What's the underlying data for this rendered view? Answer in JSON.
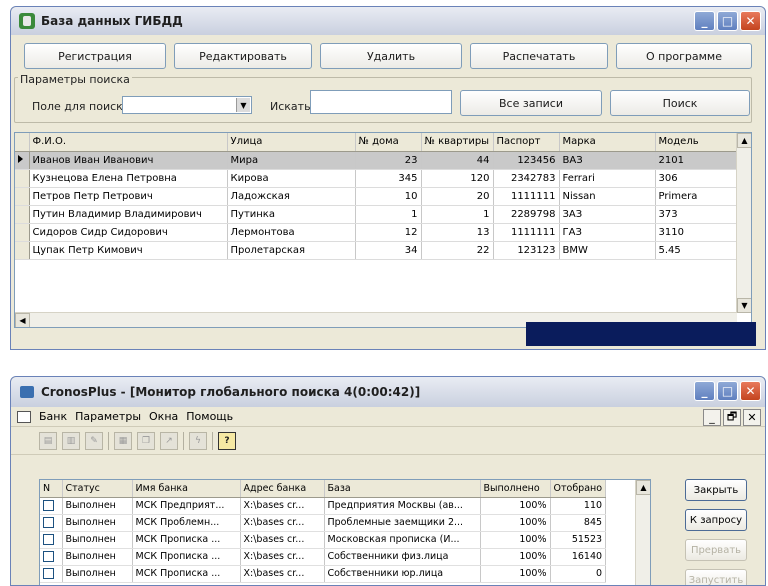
{
  "window1": {
    "title": "База данных ГИБДД",
    "buttons": {
      "register": "Регистрация",
      "edit": "Редактировать",
      "delete": "Удалить",
      "print": "Распечатать",
      "about": "О программе"
    },
    "search": {
      "group_label": "Параметры поиска",
      "field_label": "Поле для поиска",
      "field_value": "",
      "query_label": "Искать",
      "query_value": "",
      "all_records": "Все записи",
      "find": "Поиск"
    },
    "table": {
      "columns": [
        "Ф.И.О.",
        "Улица",
        "№ дома",
        "№ квартиры",
        "Паспорт",
        "Марка",
        "Модель"
      ],
      "rows": [
        [
          "Иванов Иван Иванович",
          "Мира",
          "23",
          "44",
          "123456",
          "ВАЗ",
          "2101"
        ],
        [
          "Кузнецова Елена Петровна",
          "Кирова",
          "345",
          "120",
          "2342783",
          "Ferrari",
          "306"
        ],
        [
          "Петров Петр Петрович",
          "Ладожская",
          "10",
          "20",
          "1111111",
          "Nissan",
          "Primera"
        ],
        [
          "Путин Владимир Владимирович",
          "Путинка",
          "1",
          "1",
          "2289798",
          "ЗАЗ",
          "373"
        ],
        [
          "Сидоров Сидр Сидорович",
          "Лермонтова",
          "12",
          "13",
          "1111111",
          "ГАЗ",
          "3110"
        ],
        [
          "Цупак Петр Кимович",
          "Пролетарская",
          "34",
          "22",
          "123123",
          "BMW",
          "5.45"
        ]
      ],
      "selected_row": 0
    }
  },
  "window2": {
    "title": "CronosPlus - [Монитор глобального поиска 4(0:00:42)]",
    "menu": [
      "Банк",
      "Параметры",
      "Окна",
      "Помощь"
    ],
    "toolbar_icons": [
      "save-icon",
      "save-all-icon",
      "edit-icon",
      "chart-icon",
      "copy-icon",
      "run-icon",
      "lightning-icon",
      "help-icon"
    ],
    "help_glyph": "?",
    "table": {
      "columns": [
        "N",
        "Статус",
        "Имя банка",
        "Адрес банка",
        "База",
        "Выполнено",
        "Отобрано"
      ],
      "rows": [
        [
          "",
          "Выполнен",
          "МСК Предприят...",
          "X:\\bases cr...",
          "Предприятия Москвы (ав...",
          "100%",
          "110"
        ],
        [
          "",
          "Выполнен",
          "МСК Проблемн...",
          "X:\\bases cr...",
          "Проблемные заемщики 2...",
          "100%",
          "845"
        ],
        [
          "",
          "Выполнен",
          "МСК Прописка ...",
          "X:\\bases cr...",
          "Московская прописка (И...",
          "100%",
          "51523"
        ],
        [
          "",
          "Выполнен",
          "МСК Прописка ...",
          "X:\\bases cr...",
          "Собственники физ.лица",
          "100%",
          "16140"
        ],
        [
          "",
          "Выполнен",
          "МСК Прописка ...",
          "X:\\bases cr...",
          "Собственники юр.лица",
          "100%",
          "0"
        ]
      ]
    },
    "buttons": {
      "close": "Закрыть",
      "to_query": "К запросу",
      "interrupt": "Прервать",
      "launch": "Запустить"
    }
  }
}
